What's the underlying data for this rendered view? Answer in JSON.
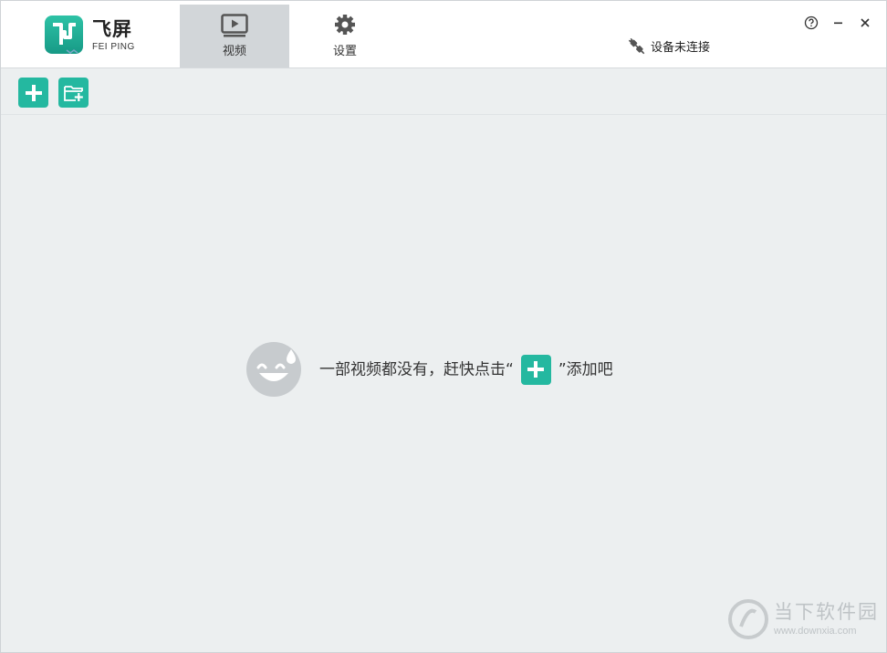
{
  "app": {
    "logo_cn": "飞屏",
    "logo_en": "FEI PING"
  },
  "nav": {
    "tabs": [
      {
        "label": "视频",
        "icon": "video-icon",
        "active": true
      },
      {
        "label": "设置",
        "icon": "gear-icon",
        "active": false
      }
    ]
  },
  "device": {
    "status_label": "设备未连接",
    "icon": "disconnected-plug-icon"
  },
  "window_controls": {
    "help": "?",
    "minimize": "−",
    "close": "×"
  },
  "toolbar": {
    "buttons": [
      {
        "name": "add-video-button",
        "icon": "plus-icon"
      },
      {
        "name": "add-folder-button",
        "icon": "folder-plus-icon"
      }
    ]
  },
  "empty_state": {
    "text_before": "一部视频都没有，赶快点击",
    "quote_open": "“",
    "quote_close": "”",
    "text_after": "添加吧",
    "icon": "sweat-smile-face-icon"
  },
  "watermark": {
    "cn": "当下软件园",
    "url": "www.downxia.com"
  },
  "colors": {
    "accent": "#24b8a0",
    "background": "#eceff0",
    "active_tab": "#d2d6d9"
  }
}
